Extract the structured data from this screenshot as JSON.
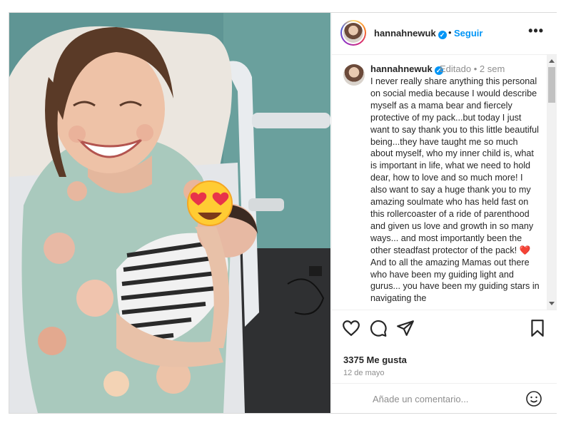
{
  "post": {
    "username": "hannahnewuk",
    "verified_icon": "verified-badge-icon",
    "separator": "•",
    "follow_label": "Seguir",
    "more_label": "•••"
  },
  "caption": {
    "username": "hannahnewuk",
    "edited": "Editado",
    "time_sep": "•",
    "time": "2 sem",
    "text": "I never really share anything this personal on social media because I would describe myself as a mama bear and fiercely protective of my pack...but today I just want to say thank you to this little beautiful being...they have taught me so much about myself, who my inner child is, what is important in life, what we need to hold dear, how to love and so much more! I also want to say a huge thank you to my amazing soulmate who has held fast on this rollercoaster of a ride of parenthood and given us love and growth in so many ways... and most importantly been the other steadfast protector of the pack! ❤️ And to all the amazing Mamas out there who have been my guiding light and gurus... you have been my guiding stars in navigating the"
  },
  "actions": {
    "like_icon": "heart-icon",
    "comment_icon": "comment-icon",
    "share_icon": "share-icon",
    "save_icon": "bookmark-icon",
    "likes": "3375 Me gusta",
    "date": "12 de mayo"
  },
  "comment": {
    "placeholder": "Añade un comentario...",
    "emoji_icon": "emoji-icon"
  },
  "photo": {
    "alt": "Mother smiling holding newborn baby in hospital bed",
    "face_sticker_icon": "heart-eyes-emoji-icon"
  },
  "colors": {
    "accent": "#0095f6",
    "text": "#262626",
    "muted": "#8e8e8e",
    "border": "#dbdbdb"
  }
}
